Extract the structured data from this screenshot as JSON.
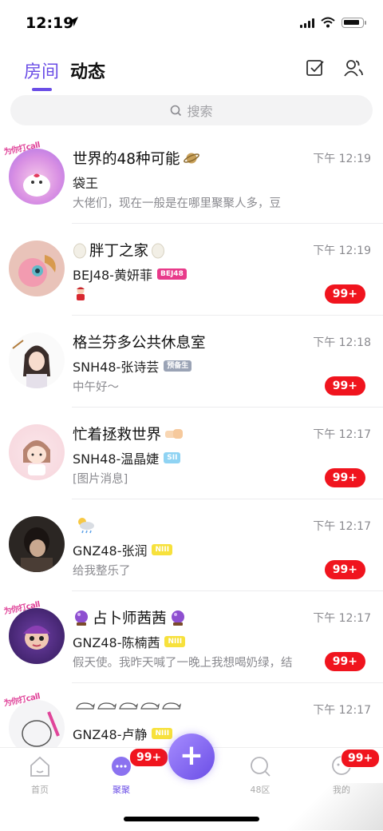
{
  "status": {
    "time": "12:19"
  },
  "header": {
    "tabs": [
      {
        "label": "房间",
        "active": true
      },
      {
        "label": "动态",
        "active": false
      }
    ],
    "accent": "#6b4ee6"
  },
  "search": {
    "placeholder": "搜索"
  },
  "rooms": [
    {
      "title": "世界的48种可能",
      "title_icon": "planet-icon",
      "sender": "袋王",
      "tag": "",
      "preview": "大佬们，现在一般是在哪里聚聚人多，豆",
      "time": "下午 12:19",
      "badge": "",
      "avatar_text": "为你打call"
    },
    {
      "title": "胖丁之家",
      "title_icon": "egg-icon",
      "sender": "BEJ48-黄妍菲",
      "tag": "BEJ48",
      "preview": "",
      "time": "下午 12:19",
      "badge": "99+"
    },
    {
      "title": "格兰芬多公共休息室",
      "title_icon": "",
      "sender": "SNH48-张诗芸",
      "tag": "预备生",
      "preview": "中午好～",
      "time": "下午 12:18",
      "badge": "99+"
    },
    {
      "title": "忙着拯救世界",
      "title_icon": "fist-icon",
      "sender": "SNH48-温晶婕",
      "tag": "SII",
      "preview": "[图片消息]",
      "time": "下午 12:17",
      "badge": "99+"
    },
    {
      "title": "",
      "title_icon": "weather-icon",
      "sender": "GNZ48-张润",
      "tag": "NIII",
      "preview": "给我整乐了",
      "time": "下午 12:17",
      "badge": "99+"
    },
    {
      "title": "占卜师茜茜",
      "title_icon": "crystal-ball-icon",
      "sender": "GNZ48-陈楠茜",
      "tag": "NIII",
      "preview": "假天使。我昨天喊了一晚上我想喝奶绿，结",
      "time": "下午 12:17",
      "badge": "99+",
      "avatar_text": "为你打call"
    },
    {
      "title": "",
      "title_icon": "cloud-pigs-icon",
      "sender": "GNZ48-卢静",
      "tag": "NIII",
      "preview": "",
      "time": "下午 12:17",
      "badge": "",
      "avatar_text": "为你打call"
    }
  ],
  "tabbar": {
    "items": [
      {
        "label": "首页"
      },
      {
        "label": "聚聚"
      },
      {
        "label": "48区"
      },
      {
        "label": "我的"
      }
    ],
    "juju_badge": "99+",
    "me_badge": "99+"
  }
}
